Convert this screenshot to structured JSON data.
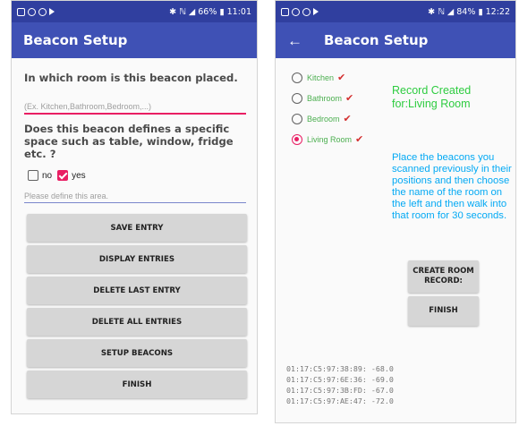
{
  "left": {
    "status": {
      "right_text": "✱ ℕ ◢ 66% ▮ 11:01"
    },
    "appbar": {
      "title": "Beacon Setup"
    },
    "question1": "In which room is this beacon placed.",
    "room_input": {
      "placeholder": "(Ex. Kitchen,Bathroom,Bedroom,...)",
      "value": ""
    },
    "question2": "Does this beacon defines a specific space such as table, window, fridge etc. ?",
    "checkbox_no": {
      "label": "no",
      "checked": false
    },
    "checkbox_yes": {
      "label": "yes",
      "checked": true
    },
    "area_input": {
      "placeholder": "Please define this area.",
      "value": ""
    },
    "buttons": {
      "save": "SAVE ENTRY",
      "display": "DISPLAY ENTRIES",
      "delete_last": "DELETE LAST ENTRY",
      "delete_all": "DELETE ALL ENTRIES",
      "setup_beacons": "SETUP BEACONS",
      "finish": "FINISH"
    }
  },
  "right": {
    "status": {
      "right_text": "✱ ℕ ◢ 84% ▮ 12:22"
    },
    "appbar": {
      "title": "Beacon Setup"
    },
    "rooms": [
      {
        "label": "Kitchen",
        "selected": false,
        "done": true
      },
      {
        "label": "Bathroom",
        "selected": false,
        "done": true
      },
      {
        "label": "Bedroom",
        "selected": false,
        "done": true
      },
      {
        "label": "Living Room",
        "selected": true,
        "done": true
      }
    ],
    "record_message": "Record Created for:Living Room",
    "instructions": "Place the beacons you scanned previously in their positions and then choose the name of the room on the left and then walk into that room for 30 seconds.",
    "buttons": {
      "create_room": "CREATE ROOM RECORD:",
      "finish": "FINISH"
    },
    "beacons": [
      "01:17:C5:97:38:89: -68.0",
      "01:17:C5:97:6E:36: -69.0",
      "01:17:C5:97:3B:FD: -67.0",
      "01:17:C5:97:AE:47: -72.0"
    ]
  },
  "colors": {
    "status_bar": "#303f9f",
    "app_bar": "#3f51b5",
    "accent": "#e91e63",
    "success_text": "#2ecc40",
    "info_text": "#03a9f4",
    "tick": "#d32f2f"
  }
}
